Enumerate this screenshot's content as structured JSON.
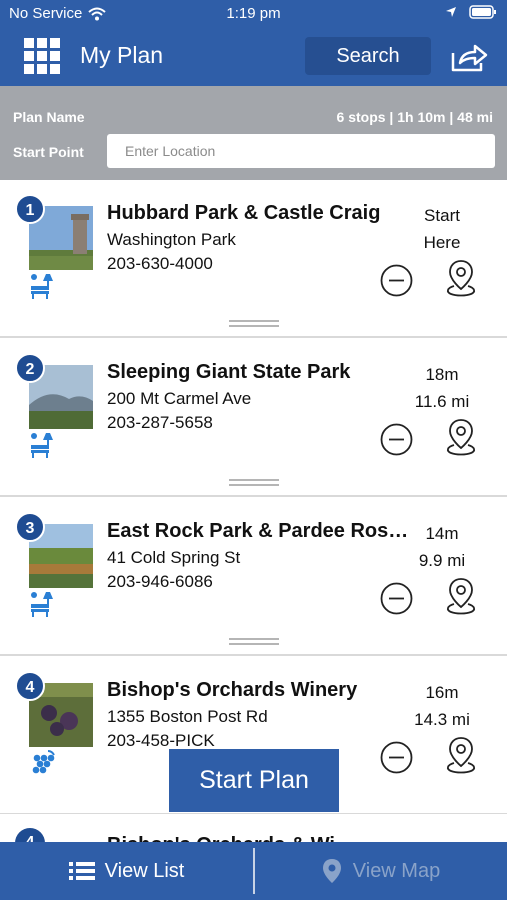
{
  "status_bar": {
    "carrier": "No Service",
    "time": "1:19 pm"
  },
  "header": {
    "title": "My Plan",
    "search_label": "Search"
  },
  "plan": {
    "name_label": "Plan Name",
    "stats": "6 stops | 1h 10m | 48 mi",
    "start_label": "Start Point",
    "location_placeholder": "Enter Location",
    "location_value": ""
  },
  "stops": [
    {
      "number": "1",
      "name": "Hubbard Park & Castle Craig",
      "address": "Washington Park",
      "phone": "203-630-4000",
      "time_line1": "Start",
      "time_line2": "Here",
      "category_icon": "park-bench-icon"
    },
    {
      "number": "2",
      "name": "Sleeping Giant State Park",
      "address": "200 Mt Carmel Ave",
      "phone": "203-287-5658",
      "time_line1": "18m",
      "time_line2": "11.6 mi",
      "category_icon": "park-bench-icon"
    },
    {
      "number": "3",
      "name": "East Rock Park & Pardee Rose...",
      "address": "41 Cold Spring St",
      "phone": "203-946-6086",
      "time_line1": "14m",
      "time_line2": "9.9 mi",
      "category_icon": "park-bench-icon"
    },
    {
      "number": "4",
      "name": "Bishop's Orchards Winery",
      "address": "1355 Boston Post Rd",
      "phone": "203-458-PICK",
      "time_line1": "16m",
      "time_line2": "14.3 mi",
      "category_icon": "grapes-icon"
    }
  ],
  "partial_stop": {
    "number": "4",
    "name": "Bishop's Orchards & Wi..."
  },
  "start_plan_label": "Start Plan",
  "tabs": {
    "list_label": "View List",
    "map_label": "View Map"
  },
  "colors": {
    "brand_blue": "#2f5ea8",
    "badge_blue": "#1f4c92",
    "info_gray": "#a3a6ab",
    "icon_blue": "#2a7fd4"
  }
}
